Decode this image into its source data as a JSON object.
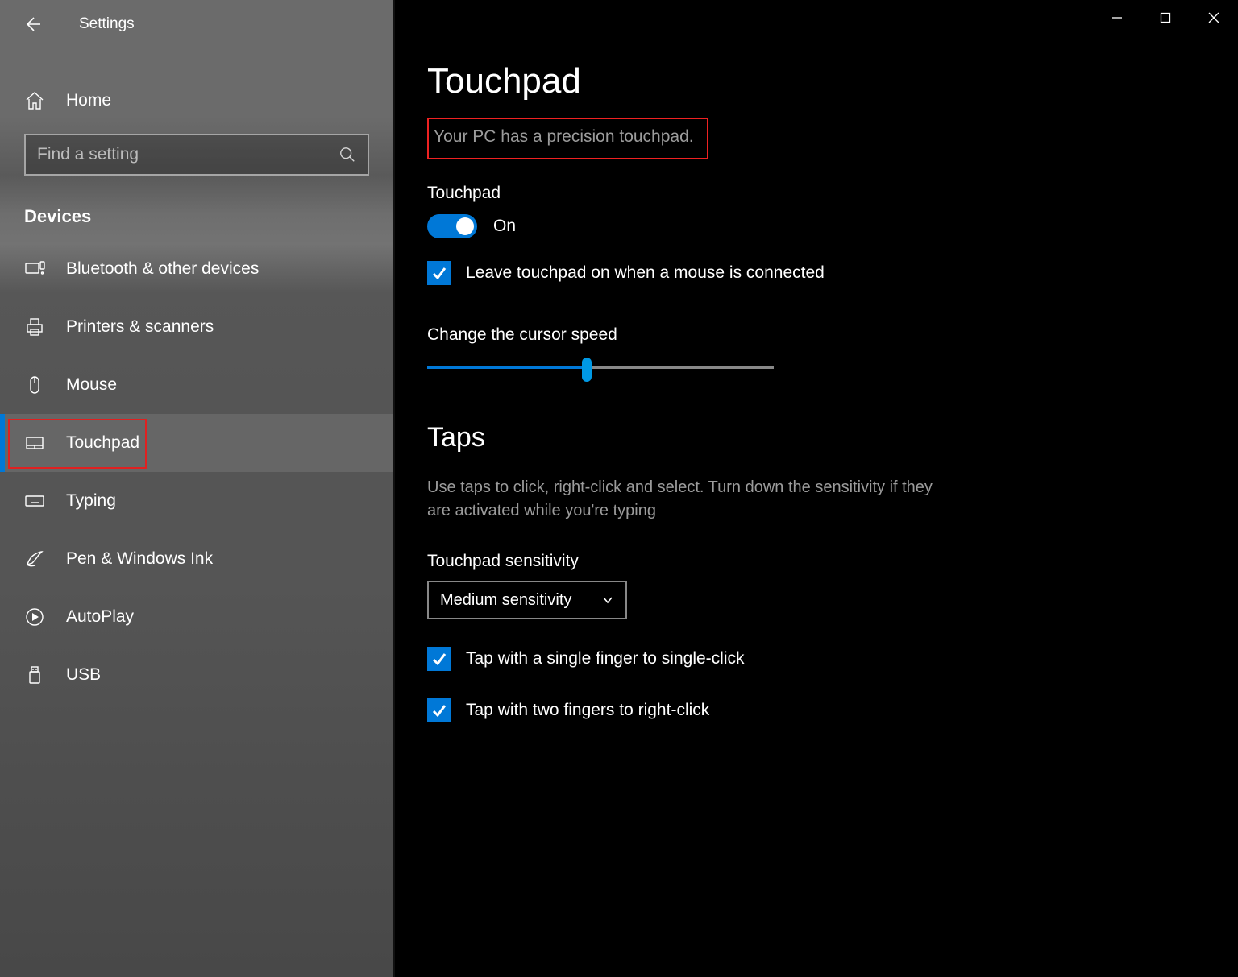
{
  "window": {
    "title": "Settings"
  },
  "sidebar": {
    "home": "Home",
    "search_placeholder": "Find a setting",
    "category": "Devices",
    "items": [
      {
        "label": "Bluetooth & other devices",
        "icon": "bt-devices-icon"
      },
      {
        "label": "Printers & scanners",
        "icon": "printer-icon"
      },
      {
        "label": "Mouse",
        "icon": "mouse-icon"
      },
      {
        "label": "Touchpad",
        "icon": "touchpad-icon",
        "selected": true
      },
      {
        "label": "Typing",
        "icon": "keyboard-icon"
      },
      {
        "label": "Pen & Windows Ink",
        "icon": "pen-icon"
      },
      {
        "label": "AutoPlay",
        "icon": "autoplay-icon"
      },
      {
        "label": "USB",
        "icon": "usb-icon"
      }
    ]
  },
  "main": {
    "title": "Touchpad",
    "precision_text": "Your PC has a precision touchpad.",
    "touchpad_label": "Touchpad",
    "toggle_state": "On",
    "leave_on_label": "Leave touchpad on when a mouse is connected",
    "cursor_speed_label": "Change the cursor speed",
    "cursor_speed_value_pct": 46,
    "taps_heading": "Taps",
    "taps_desc": "Use taps to click, right-click and select. Turn down the sensitivity if they are activated while you're typing",
    "sensitivity_label": "Touchpad sensitivity",
    "sensitivity_value": "Medium sensitivity",
    "tap_single_label": "Tap with a single finger to single-click",
    "tap_two_label": "Tap with two fingers to right-click"
  },
  "colors": {
    "accent": "#0078d7",
    "highlight": "#e22222"
  }
}
